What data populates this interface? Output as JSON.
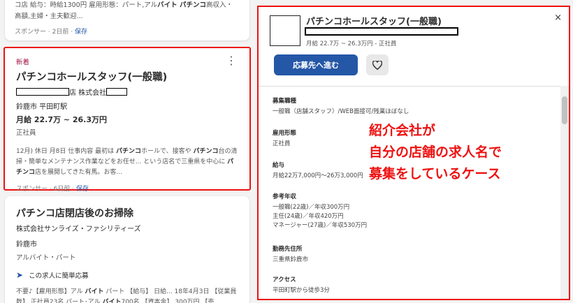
{
  "top_card": {
    "snippet": "コ店 給与：時給1300円 雇用形態：パート,アル",
    "snippet_bold": "バイト パチンコ",
    "snippet_tail": "高収入・",
    "snippet_line2": "高額,主婦・主夫歓迎...",
    "sponsor": "スポンサー",
    "time": "2日前",
    "save": "保存"
  },
  "main_card": {
    "new_label": "新着",
    "title": "パチンコホールスタッフ(一般職)",
    "company_mid": "店 株式会社",
    "location": "鈴鹿市 平田町駅",
    "salary": "月給 22.7万 ~ 26.3万円",
    "employment": "正社員",
    "desc": [
      {
        "t": "12月) 休日 月8日 仕事内容 最初は ",
        "b": false
      },
      {
        "t": "パチンコ",
        "b": true
      },
      {
        "t": "ホールで、接客や ",
        "b": false
      },
      {
        "t": "パチンコ",
        "b": true
      },
      {
        "t": "台の清掃・簡単なメンテナンス作業などをお任せ... という店名で三重県を中心に ",
        "b": false
      },
      {
        "t": "パチンコ",
        "b": true
      },
      {
        "t": "店を展開してきた有馬。お客...",
        "b": false
      }
    ],
    "sponsor": "スポンサー",
    "time": "6日前",
    "save": "保存"
  },
  "third_card": {
    "title": "パチンコ店閉店後のお掃除",
    "company": "株式会社サンライズ・ファシリティーズ",
    "location": "鈴鹿市",
    "employment": "アルバイト・パート",
    "easy_apply": "この求人に簡単応募",
    "desc": [
      {
        "t": "不要♪【雇用形態】アル ",
        "b": false
      },
      {
        "t": "バイト",
        "b": true
      },
      {
        "t": " パート 【給与】 日給... 18年4月3日 【従業員数】 正社員23名 パート･アル ",
        "b": false
      },
      {
        "t": "バイト",
        "b": true
      },
      {
        "t": "700名 【資本金】 300万円 【売",
        "b": false
      }
    ]
  },
  "detail": {
    "title": "パチンコホールスタッフ(一般職)",
    "salary_line": "月給 22.7万 ~ 26.3万円 - 正社員",
    "close": "×",
    "apply": "応募先へ進む",
    "sections": [
      {
        "h": "募集職種",
        "v": [
          "一般職（店舗スタッフ）/WEB面接可/残業ほぼなし"
        ]
      },
      {
        "h": "雇用形態",
        "v": [
          "正社員"
        ]
      },
      {
        "h": "給与",
        "v": [
          "月給22万7,000円～26万3,000円"
        ]
      },
      {
        "h": "参考年収",
        "v": [
          "一般職(22歳)／年収300万円",
          "主任(24歳)／年収420万円",
          "マネージャー(27歳)／年収530万円"
        ]
      },
      {
        "h": "勤務先住所",
        "v": [
          "三重県鈴鹿市"
        ]
      },
      {
        "h": "アクセス",
        "v": [
          "平田町駅から徒歩3分"
        ]
      }
    ]
  },
  "annotation": [
    "紹介会社が",
    "自分の店舗の求人名で",
    "募集をしているケース"
  ],
  "colors": {
    "accent": "#2557a7",
    "highlight_border": "#ee1111",
    "new_label": "#a5184a"
  }
}
